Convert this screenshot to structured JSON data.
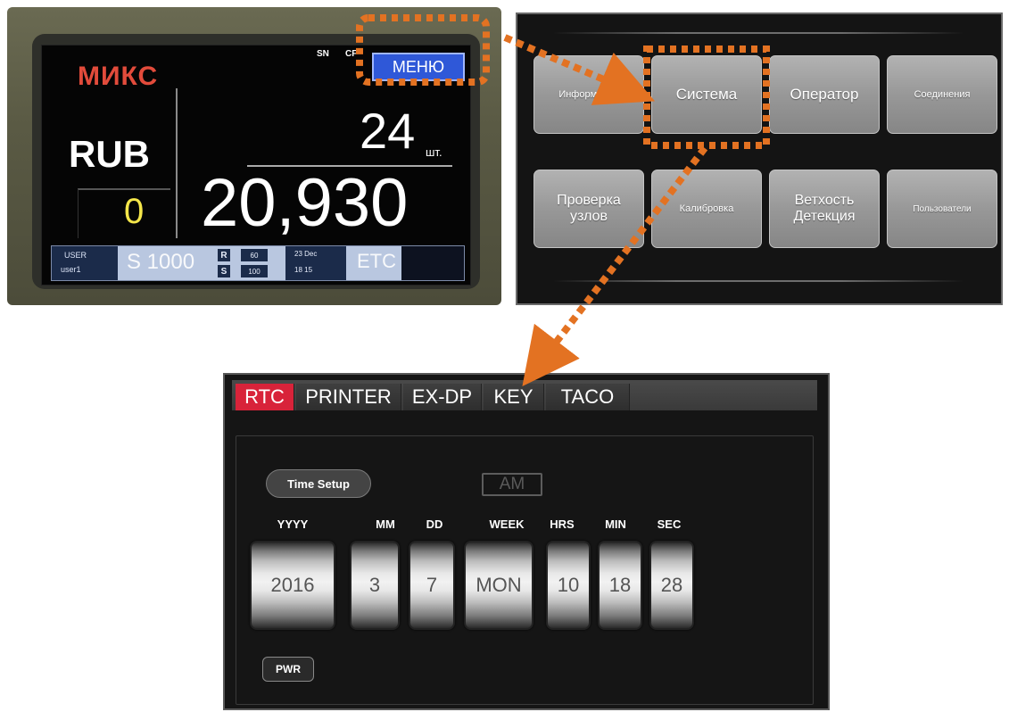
{
  "main_screen": {
    "mode_label": "МИКС",
    "sn_label": "SN",
    "cf_label": "CF",
    "menu_button": "МЕНЮ",
    "currency": "RUB",
    "denomination_count": "0",
    "note_count": "24",
    "note_unit": "шт.",
    "total_amount": "20,930",
    "status_bar": {
      "user_label": "USER",
      "user_name": "user1",
      "mode_text": "S 1000",
      "r_label": "R",
      "s_label": "S",
      "r_value": "60",
      "s_value": "100",
      "date_text": "23 Dec",
      "time_text": "18  15",
      "etc_label": "ETC"
    }
  },
  "menu_grid": {
    "items": [
      {
        "label": "Информация"
      },
      {
        "label": "Система"
      },
      {
        "label": "Оператор"
      },
      {
        "label": "Соединения"
      },
      {
        "label": "Проверка узлов"
      },
      {
        "label": "Калибровка"
      },
      {
        "label": "Ветхость Детекция"
      },
      {
        "label": "Пользователи"
      }
    ]
  },
  "rtc_screen": {
    "tabs": [
      {
        "label": "RTC",
        "active": true
      },
      {
        "label": "PRINTER",
        "active": false
      },
      {
        "label": "EX-DP",
        "active": false
      },
      {
        "label": "KEY",
        "active": false
      },
      {
        "label": "TACO",
        "active": false
      }
    ],
    "time_setup_label": "Time Setup",
    "ampm": "AM",
    "fields": [
      {
        "label": "YYYY",
        "value": "2016"
      },
      {
        "label": "MM",
        "value": "3"
      },
      {
        "label": "DD",
        "value": "7"
      },
      {
        "label": "WEEK",
        "value": "MON"
      },
      {
        "label": "HRS",
        "value": "10"
      },
      {
        "label": "MIN",
        "value": "18"
      },
      {
        "label": "SEC",
        "value": "28"
      }
    ],
    "pwr_label": "PWR"
  },
  "colors": {
    "highlight": "#e37222",
    "active_tab": "#d8233a",
    "menu_button": "#2f58d8",
    "mix_text": "#e24b3b",
    "count_text": "#f4e64a"
  }
}
